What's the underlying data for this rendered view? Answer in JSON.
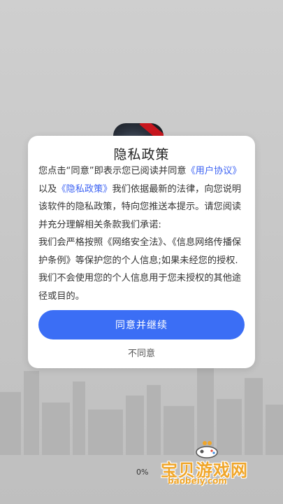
{
  "dialog": {
    "title": "隐私政策",
    "paragraphs": [
      {
        "parts": [
          {
            "text": "您点击“同意”即表示您已阅读并同意"
          },
          {
            "text": "《用户协议》",
            "link": true
          },
          {
            "text": "以及"
          },
          {
            "text": "《隐私政策》",
            "link": true
          },
          {
            "text": "我们依据最新的法律，向您说明该软件的隐私政策，特向您推送本提示。请您阅读并充分理解相关条款我们承诺:"
          }
        ]
      },
      {
        "parts": [
          {
            "text": "我们会严格按照《网络安全法》、《信息网络传播保护条例》等保护您的个人信息;如果未经您的授权."
          }
        ]
      },
      {
        "parts": [
          {
            "text": "我们不会使用您的个人信息用于您未授权的其他途径或目的。"
          }
        ]
      }
    ],
    "agree_label": "同意并继续",
    "disagree_label": "不同意"
  },
  "loading": {
    "progress_text": "0%"
  },
  "watermark": {
    "name": "宝贝游戏网",
    "url": "baobeiy.com"
  },
  "colors": {
    "accent": "#3b6ef5",
    "link": "#3d63f3",
    "watermark": "#f0a62a"
  }
}
